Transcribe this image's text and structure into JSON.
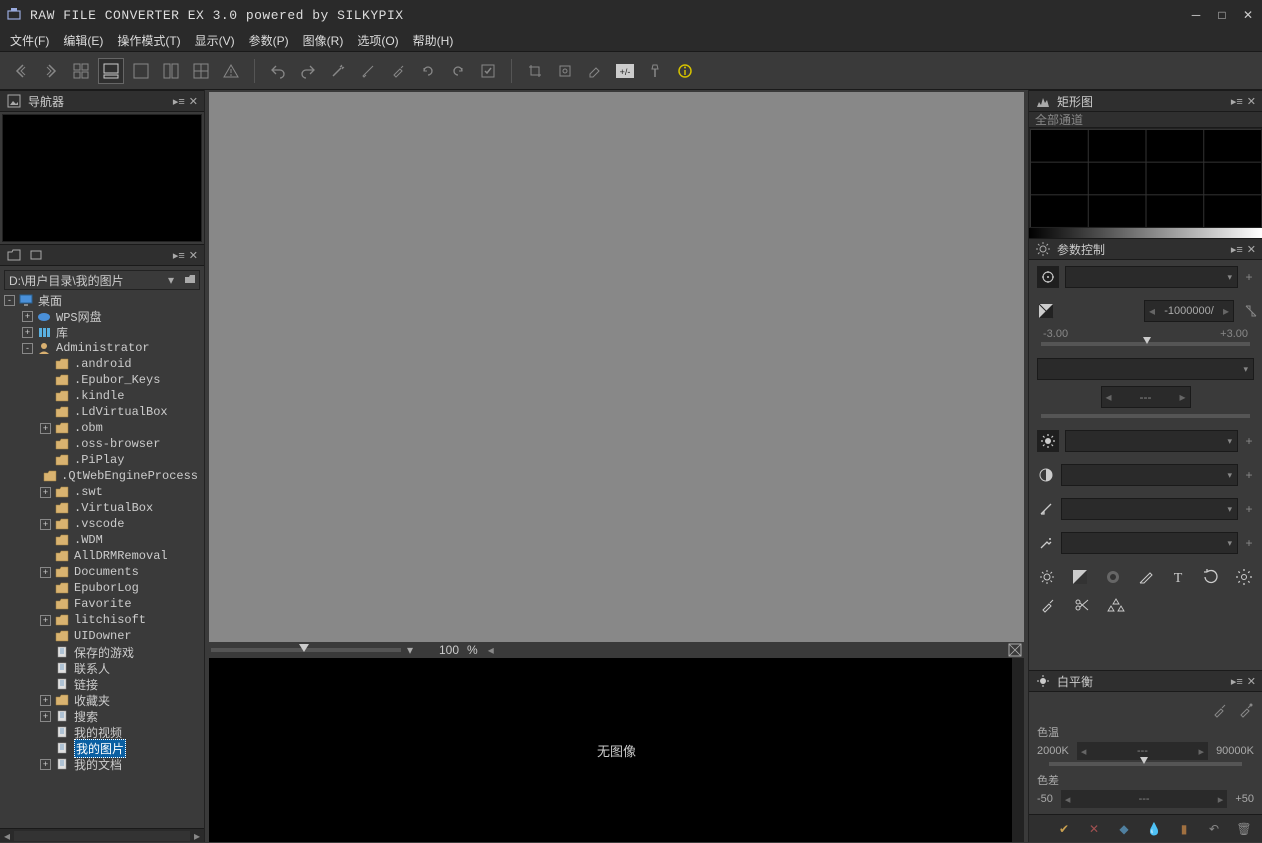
{
  "title": "RAW FILE CONVERTER EX 3.0 powered by SILKYPIX",
  "menus": {
    "file": "文件(F)",
    "edit": "编辑(E)",
    "mode": "操作模式(T)",
    "view": "显示(V)",
    "param": "参数(P)",
    "image": "图像(R)",
    "option": "选项(O)",
    "help": "帮助(H)"
  },
  "toolbar": {
    "groups": [
      "prev",
      "next",
      "grid4",
      "grid2",
      "single",
      "split",
      "split3",
      "grid9",
      "warn",
      "undo",
      "redo",
      "wand",
      "brush",
      "brush2",
      "rotate-l",
      "rotate-r",
      "check",
      "crop",
      "crop2",
      "eraser",
      "histogram",
      "pipette",
      "info"
    ]
  },
  "left": {
    "navigator_title": "导航器",
    "folder_path": "D:\\用户目录\\我的图片",
    "tree": [
      {
        "depth": 0,
        "expand": "-",
        "icon": "monitor",
        "label": "桌面"
      },
      {
        "depth": 1,
        "expand": "+",
        "icon": "cloud",
        "label": "WPS网盘"
      },
      {
        "depth": 1,
        "expand": "+",
        "icon": "lib",
        "label": "库"
      },
      {
        "depth": 1,
        "expand": "-",
        "icon": "user",
        "label": "Administrator"
      },
      {
        "depth": 2,
        "expand": "",
        "icon": "folder",
        "label": ".android"
      },
      {
        "depth": 2,
        "expand": "",
        "icon": "folder",
        "label": ".Epubor_Keys"
      },
      {
        "depth": 2,
        "expand": "",
        "icon": "folder",
        "label": ".kindle"
      },
      {
        "depth": 2,
        "expand": "",
        "icon": "folder",
        "label": ".LdVirtualBox"
      },
      {
        "depth": 2,
        "expand": "+",
        "icon": "folder",
        "label": ".obm"
      },
      {
        "depth": 2,
        "expand": "",
        "icon": "folder",
        "label": ".oss-browser"
      },
      {
        "depth": 2,
        "expand": "",
        "icon": "folder",
        "label": ".PiPlay"
      },
      {
        "depth": 2,
        "expand": "",
        "icon": "folder",
        "label": ".QtWebEngineProcess"
      },
      {
        "depth": 2,
        "expand": "+",
        "icon": "folder",
        "label": ".swt"
      },
      {
        "depth": 2,
        "expand": "",
        "icon": "folder",
        "label": ".VirtualBox"
      },
      {
        "depth": 2,
        "expand": "+",
        "icon": "folder",
        "label": ".vscode"
      },
      {
        "depth": 2,
        "expand": "",
        "icon": "folder",
        "label": ".WDM"
      },
      {
        "depth": 2,
        "expand": "",
        "icon": "folder",
        "label": "AllDRMRemoval"
      },
      {
        "depth": 2,
        "expand": "+",
        "icon": "folder",
        "label": "Documents"
      },
      {
        "depth": 2,
        "expand": "",
        "icon": "folder",
        "label": "EpuborLog"
      },
      {
        "depth": 2,
        "expand": "",
        "icon": "folder",
        "label": "Favorite"
      },
      {
        "depth": 2,
        "expand": "+",
        "icon": "folder",
        "label": "litchisoft"
      },
      {
        "depth": 2,
        "expand": "",
        "icon": "folder",
        "label": "UIDowner"
      },
      {
        "depth": 2,
        "expand": "",
        "icon": "doc",
        "label": "保存的游戏"
      },
      {
        "depth": 2,
        "expand": "",
        "icon": "doc",
        "label": "联系人"
      },
      {
        "depth": 2,
        "expand": "",
        "icon": "doc",
        "label": "链接"
      },
      {
        "depth": 2,
        "expand": "+",
        "icon": "folder",
        "label": "收藏夹"
      },
      {
        "depth": 2,
        "expand": "+",
        "icon": "doc",
        "label": "搜索"
      },
      {
        "depth": 2,
        "expand": "",
        "icon": "doc",
        "label": "我的视频"
      },
      {
        "depth": 2,
        "expand": "",
        "icon": "doc",
        "label": "我的图片",
        "selected": true
      },
      {
        "depth": 2,
        "expand": "+",
        "icon": "doc",
        "label": "我的文档"
      }
    ]
  },
  "center": {
    "zoom_value": "100",
    "zoom_unit": "%",
    "no_image": "无图像"
  },
  "right": {
    "histogram_title": "矩形图",
    "histogram_channel": "全部通道",
    "param_title": "参数控制",
    "exposure_value": "-1000000/",
    "exposure_min": "-3.00",
    "exposure_max": "+3.00",
    "blank_value": "---",
    "wb_title": "白平衡",
    "wb_temp_label": "色温",
    "wb_temp_min": "2000K",
    "wb_temp_mid": "---",
    "wb_temp_max": "90000K",
    "wb_tint_label": "色差",
    "wb_tint_min": "-50",
    "wb_tint_mid": "---",
    "wb_tint_max": "+50"
  }
}
